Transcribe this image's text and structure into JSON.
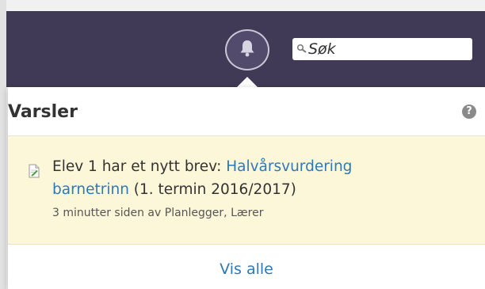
{
  "header": {
    "search": {
      "placeholder": "Søk"
    },
    "icons": {
      "bell": "bell-icon",
      "search": "search-icon"
    },
    "colors": {
      "bar": "#403a56"
    }
  },
  "notifications": {
    "title": "Varsler",
    "help_label": "?",
    "items": [
      {
        "icon": "document-icon",
        "prefix": "Elev 1 har et nytt brev: ",
        "link_part1": "Halvårsvurdering",
        "link_part2": "barnetrinn",
        "suffix": " (1. termin 2016/2017)",
        "meta": "3 minutter siden av Planlegger, Lærer"
      }
    ],
    "view_all": "Vis alle",
    "colors": {
      "highlight": "#fcf7d9",
      "link": "#2f78b7"
    }
  }
}
